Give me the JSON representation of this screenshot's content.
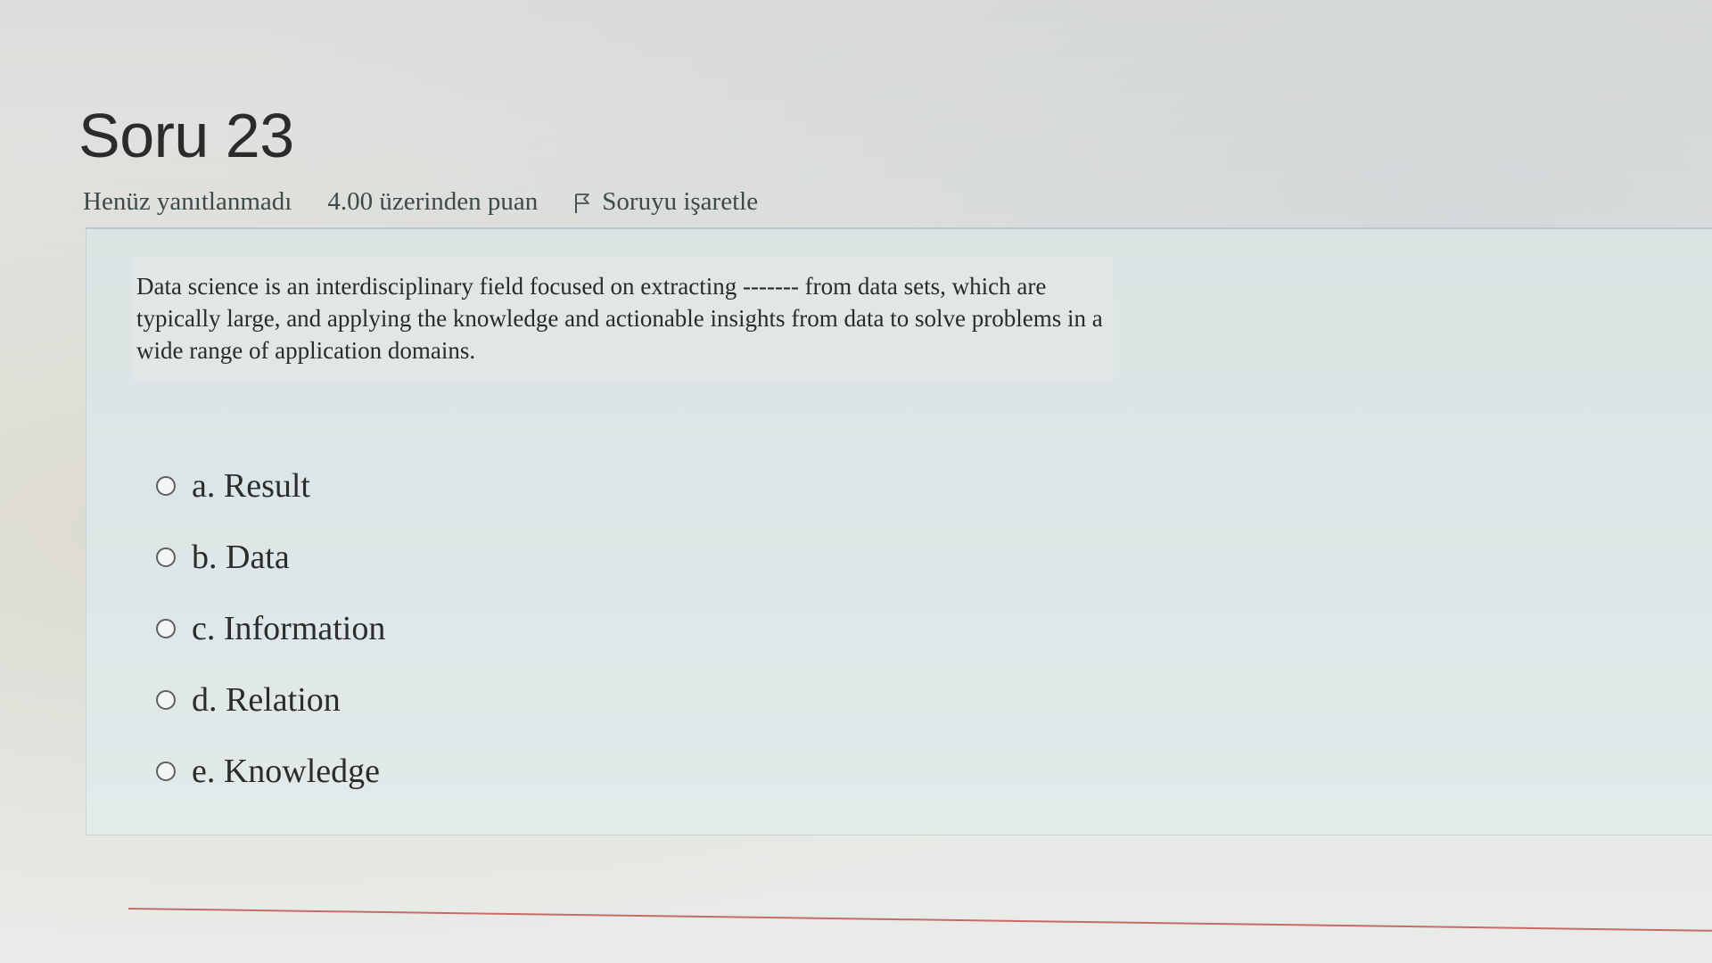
{
  "question": {
    "title": "Soru 23",
    "state": "Henüz yanıtlanmadı",
    "grade": "4.00 üzerinden puan",
    "flag_label": "Soruyu işaretle",
    "flag_icon": "flag-icon",
    "text": "Data science is an interdisciplinary field focused on extracting ------- from data sets, which are typically large, and applying the knowledge and actionable insights from data to solve problems in a wide range of application domains.",
    "answers": [
      {
        "label": "a. Result",
        "checked": false
      },
      {
        "label": "b. Data",
        "checked": false
      },
      {
        "label": "c. Information",
        "checked": false
      },
      {
        "label": "d. Relation",
        "checked": false
      },
      {
        "label": "e. Knowledge",
        "checked": false
      }
    ]
  }
}
